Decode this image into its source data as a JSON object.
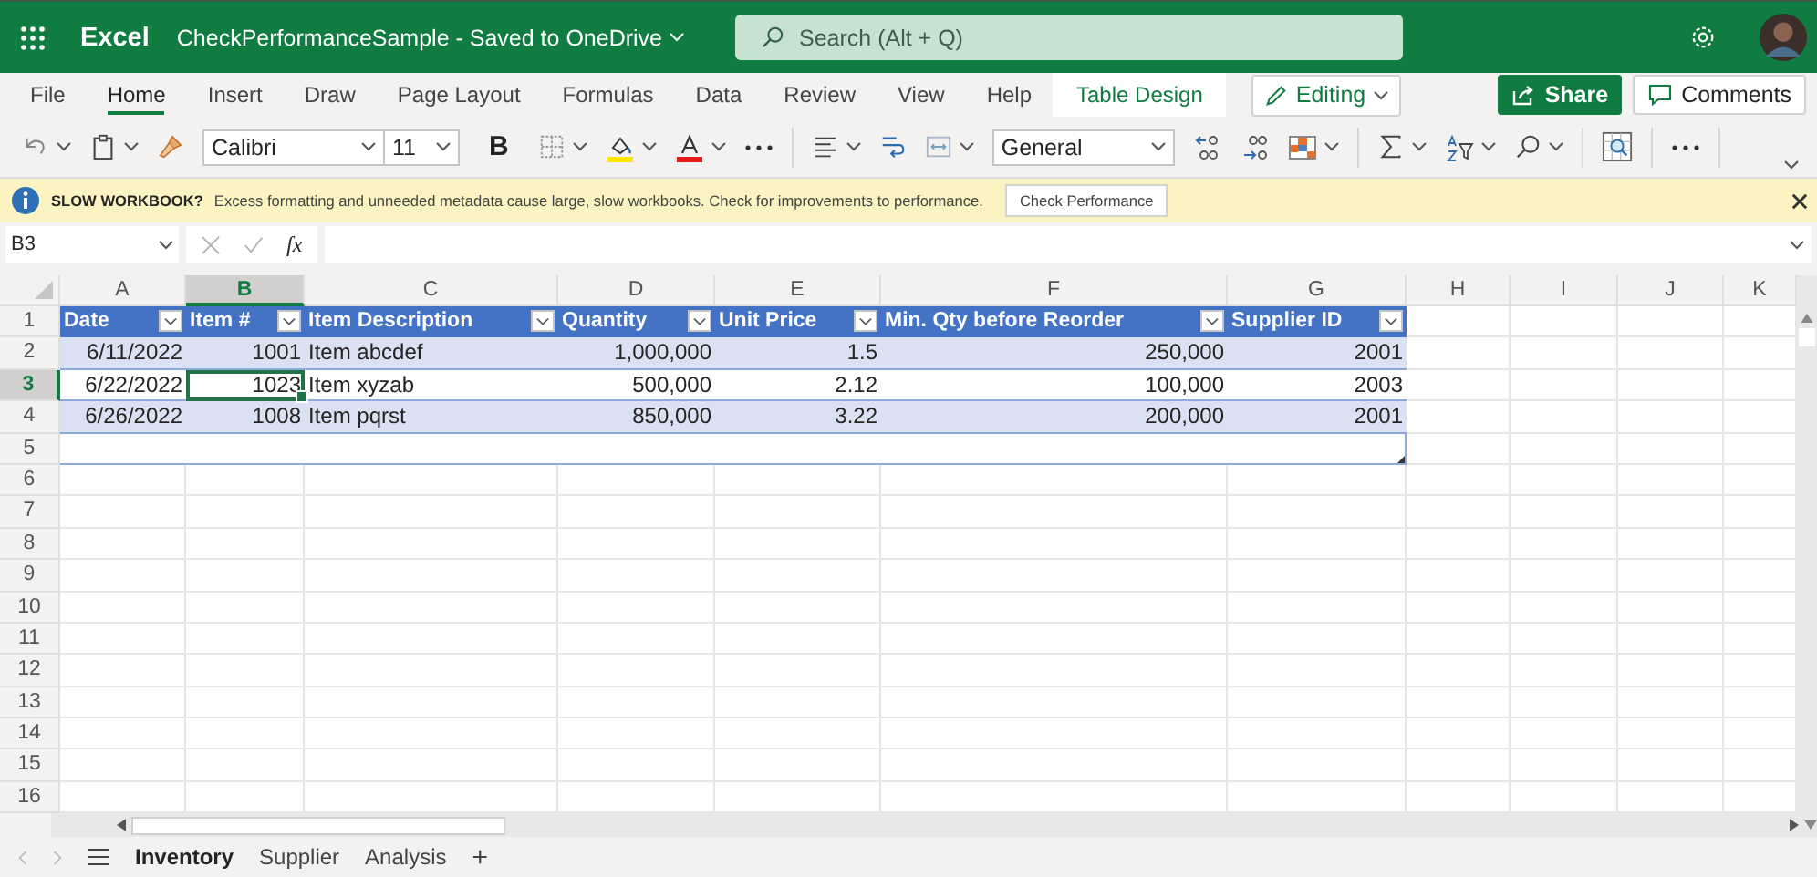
{
  "header": {
    "app": "Excel",
    "document": "CheckPerformanceSample",
    "separator": "-",
    "save_status": "Saved to OneDrive",
    "search_placeholder": "Search (Alt + Q)"
  },
  "ribbon_tabs": [
    {
      "label": "File",
      "selected": false,
      "kind": "normal"
    },
    {
      "label": "Home",
      "selected": true,
      "kind": "normal"
    },
    {
      "label": "Insert",
      "selected": false,
      "kind": "normal"
    },
    {
      "label": "Draw",
      "selected": false,
      "kind": "normal"
    },
    {
      "label": "Page Layout",
      "selected": false,
      "kind": "normal"
    },
    {
      "label": "Formulas",
      "selected": false,
      "kind": "normal"
    },
    {
      "label": "Data",
      "selected": false,
      "kind": "normal"
    },
    {
      "label": "Review",
      "selected": false,
      "kind": "normal"
    },
    {
      "label": "View",
      "selected": false,
      "kind": "normal"
    },
    {
      "label": "Help",
      "selected": false,
      "kind": "normal"
    },
    {
      "label": "Table Design",
      "selected": false,
      "kind": "contextual"
    }
  ],
  "mode_button": "Editing",
  "share_button": "Share",
  "comments_button": "Comments",
  "toolbar": {
    "font": "Calibri",
    "size": "11",
    "bold": "B",
    "number_format": "General"
  },
  "notification": {
    "title": "SLOW WORKBOOK?",
    "message": "Excess formatting and unneeded metadata cause large, slow workbooks. Check for improvements to performance.",
    "button": "Check Performance"
  },
  "formula_bar": {
    "name_box": "B3",
    "fx": "fx"
  },
  "grid": {
    "columns": [
      {
        "letter": "A",
        "selected": false
      },
      {
        "letter": "B",
        "selected": true
      },
      {
        "letter": "C",
        "selected": false
      },
      {
        "letter": "D",
        "selected": false
      },
      {
        "letter": "E",
        "selected": false
      },
      {
        "letter": "F",
        "selected": false
      },
      {
        "letter": "G",
        "selected": false
      },
      {
        "letter": "H",
        "selected": false
      },
      {
        "letter": "I",
        "selected": false
      },
      {
        "letter": "J",
        "selected": false
      },
      {
        "letter": "K",
        "selected": false
      }
    ],
    "rows": [
      {
        "number": "1",
        "selected": false
      },
      {
        "number": "2",
        "selected": false
      },
      {
        "number": "3",
        "selected": true
      },
      {
        "number": "4",
        "selected": false
      },
      {
        "number": "5",
        "selected": false
      },
      {
        "number": "6",
        "selected": false
      },
      {
        "number": "7",
        "selected": false
      },
      {
        "number": "8",
        "selected": false
      },
      {
        "number": "9",
        "selected": false
      },
      {
        "number": "10",
        "selected": false
      },
      {
        "number": "11",
        "selected": false
      },
      {
        "number": "12",
        "selected": false
      },
      {
        "number": "13",
        "selected": false
      },
      {
        "number": "14",
        "selected": false
      },
      {
        "number": "15",
        "selected": false
      },
      {
        "number": "16",
        "selected": false
      }
    ]
  },
  "table": {
    "columns": [
      {
        "header": "Date",
        "kind": "number"
      },
      {
        "header": "Item #",
        "kind": "number"
      },
      {
        "header": "Item Description",
        "kind": "text"
      },
      {
        "header": "Quantity",
        "kind": "number"
      },
      {
        "header": "Unit Price",
        "kind": "number"
      },
      {
        "header": "Min. Qty before Reorder",
        "kind": "number"
      },
      {
        "header": "Supplier ID",
        "kind": "number"
      }
    ],
    "rows": [
      {
        "cells": [
          {
            "text": "6/11/2022",
            "selected": false
          },
          {
            "text": "1001",
            "selected": false
          },
          {
            "text": "Item abcdef",
            "selected": false
          },
          {
            "text": "1,000,000",
            "selected": false
          },
          {
            "text": "1.5",
            "selected": false
          },
          {
            "text": "250,000",
            "selected": false
          },
          {
            "text": "2001",
            "selected": false
          }
        ]
      },
      {
        "cells": [
          {
            "text": "6/22/2022",
            "selected": false
          },
          {
            "text": "1023",
            "selected": true
          },
          {
            "text": "Item xyzab",
            "selected": false
          },
          {
            "text": "500,000",
            "selected": false
          },
          {
            "text": "2.12",
            "selected": false
          },
          {
            "text": "100,000",
            "selected": false
          },
          {
            "text": "2003",
            "selected": false
          }
        ]
      },
      {
        "cells": [
          {
            "text": "6/26/2022",
            "selected": false
          },
          {
            "text": "1008",
            "selected": false
          },
          {
            "text": "Item pqrst",
            "selected": false
          },
          {
            "text": "850,000",
            "selected": false
          },
          {
            "text": "3.22",
            "selected": false
          },
          {
            "text": "200,000",
            "selected": false
          },
          {
            "text": "2001",
            "selected": false
          }
        ]
      }
    ]
  },
  "sheet_tabs": [
    {
      "label": "Inventory",
      "selected": true
    },
    {
      "label": "Supplier",
      "selected": false
    },
    {
      "label": "Analysis",
      "selected": false
    }
  ],
  "add_sheet": "+"
}
